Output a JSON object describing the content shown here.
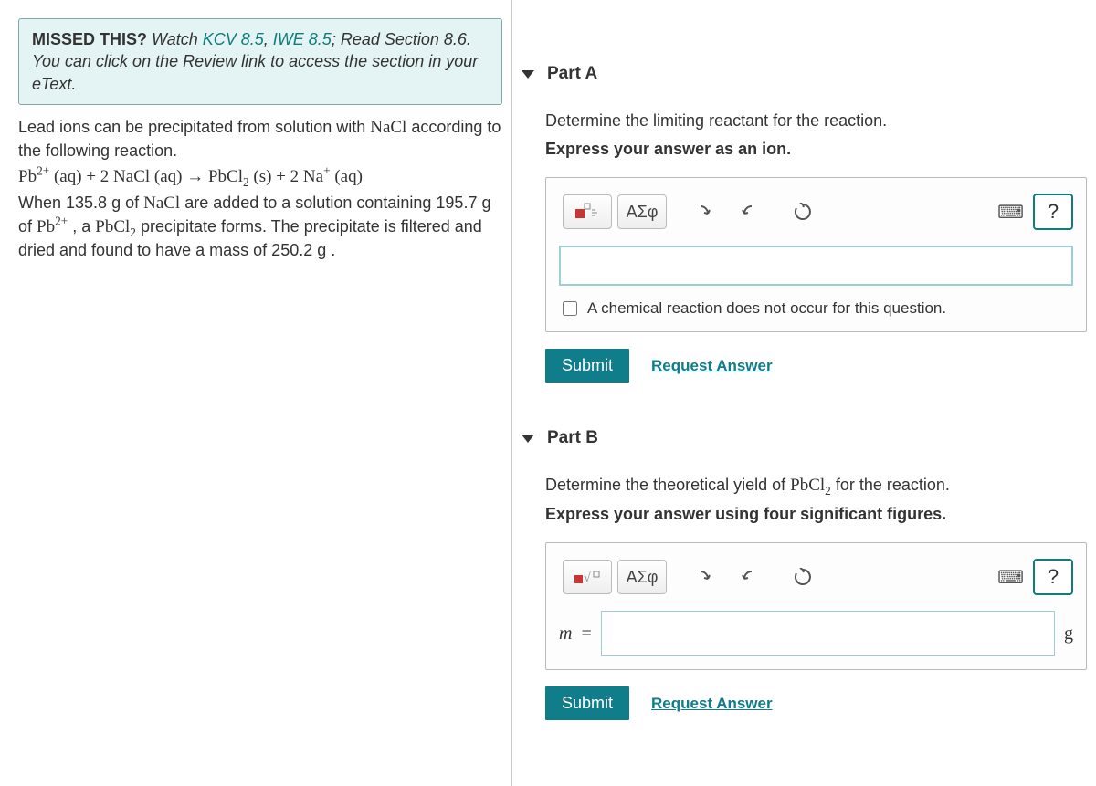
{
  "hint": {
    "prefix": "MISSED THIS?",
    "watch": "Watch",
    "kcv": "KCV 8.5",
    "iwe": "IWE 8.5",
    "rest": "; Read Section 8.6. You can click on the Review link to access the section in your eText."
  },
  "problem": {
    "intro1": "Lead ions can be precipitated from solution with ",
    "nacl": "NaCl",
    "intro2": " according to the following reaction.",
    "eq_lhs_pb": "Pb",
    "eq_pb_charge": "2+",
    "eq_aq1": " (aq) + 2 NaCl (aq) → PbCl",
    "eq_sub2": "2",
    "eq_prod": " (s) + 2 Na",
    "eq_na_charge": "+",
    "eq_aq2": " (aq)",
    "line2a": "When 135.8 g of ",
    "line2b": " are added to a solution containing 195.7 g of ",
    "pb_ion_label": "Pb",
    "pb_ion_charge": "2+",
    "line2c": " , a ",
    "pbcl2_label": "PbCl",
    "line2d": " precipitate forms. The precipitate is filtered and dried and found to have a mass of 250.2 g ."
  },
  "partA": {
    "title": "Part A",
    "prompt1": "Determine the limiting reactant for the reaction.",
    "prompt2": "Express your answer as an ion.",
    "greek_btn": "ΑΣφ",
    "help": "?",
    "no_reaction": "A chemical reaction does not occur for this question.",
    "submit": "Submit",
    "request": "Request Answer"
  },
  "partB": {
    "title": "Part B",
    "prompt1_a": "Determine the theoretical yield of ",
    "prompt1_b": " for the reaction.",
    "prompt2": "Express your answer using four significant figures.",
    "greek_btn": "ΑΣφ",
    "help": "?",
    "var": "m",
    "eq": " =",
    "unit": "g",
    "submit": "Submit",
    "request": "Request Answer"
  }
}
